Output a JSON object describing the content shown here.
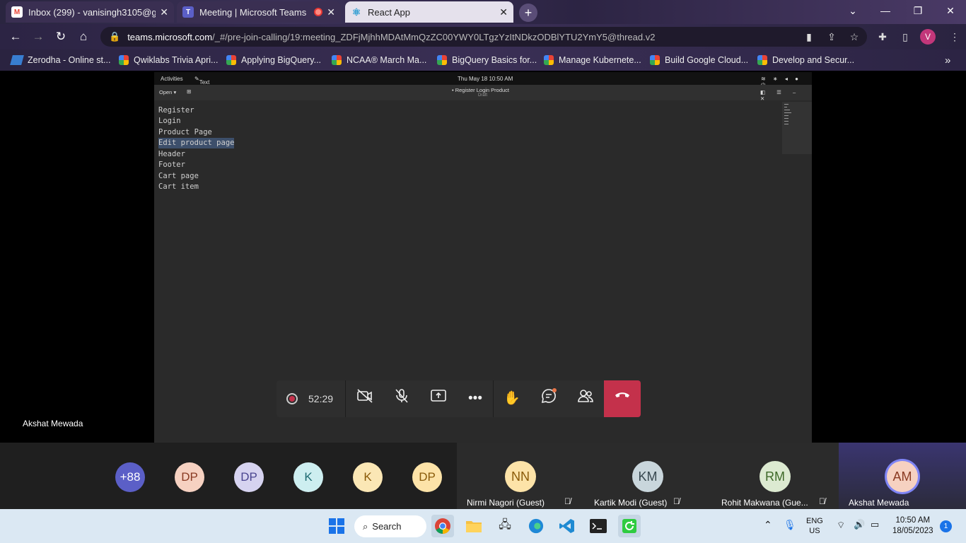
{
  "browser": {
    "tabs": [
      {
        "label": "Inbox (299) - vanisingh3105@gm",
        "icon": "gmail-icon"
      },
      {
        "label": "Meeting | Microsoft Teams",
        "icon": "teams-icon"
      },
      {
        "label": "React App",
        "icon": "react-icon"
      }
    ],
    "url_host": "teams.microsoft.com",
    "url_path": "/_#/pre-join-calling/19:meeting_ZDFjMjhhMDAtMmQzZC00YWY0LTgzYzItNDkzODBlYTU2YmY5@thread.v2",
    "profile_initial": "V",
    "bookmarks": [
      "Zerodha - Online st...",
      "Qwiklabs Trivia Apri...",
      "Applying BigQuery...",
      "NCAA® March Ma...",
      "BigQuery Basics for...",
      "Manage Kubernete...",
      "Build Google Cloud...",
      "Develop and Secur..."
    ]
  },
  "shared_screen": {
    "activities": "Activities",
    "app_name": "Text Editor",
    "clock": "Thu May 18  10:50 AM",
    "open_label": "Open",
    "doc_title": "• Register Login Product",
    "doc_subtitle": "Draft",
    "lines": [
      "Register",
      "Login",
      "Product Page",
      "Edit product page",
      "Header",
      "Footer",
      "Cart page",
      "Cart item"
    ],
    "selected_line": 3
  },
  "call": {
    "timer": "52:29",
    "presenter": "Akshat Mewada"
  },
  "participants": {
    "overflow": "+88",
    "small": [
      {
        "initials": "DP",
        "bg": "#f6d1c1",
        "fg": "#8a3b23"
      },
      {
        "initials": "DP",
        "bg": "#d6d3f0",
        "fg": "#4a4590"
      },
      {
        "initials": "K",
        "bg": "#cdeef0",
        "fg": "#1e6b72"
      },
      {
        "initials": "K",
        "bg": "#fbe7b5",
        "fg": "#8a5b0a"
      },
      {
        "initials": "DP",
        "bg": "#fde3a8",
        "fg": "#8a5b0a"
      }
    ],
    "tiles": [
      {
        "initials": "NN",
        "name": "Nirmi Nagori (Guest)",
        "bg": "#fde3a8",
        "fg": "#8a5b0a"
      },
      {
        "initials": "KM",
        "name": "Kartik Modi (Guest)",
        "bg": "#c9d6dc",
        "fg": "#37474f"
      },
      {
        "initials": "RM",
        "name": "Rohit Makwana (Gue...",
        "bg": "#dcead1",
        "fg": "#3f6a2a"
      },
      {
        "initials": "AM",
        "name": "Akshat Mewada",
        "bg": "#f6d1c1",
        "fg": "#8a3b23"
      }
    ]
  },
  "taskbar": {
    "search_label": "Search",
    "lang_top": "ENG",
    "lang_bottom": "US",
    "time": "10:50 AM",
    "date": "18/05/2023",
    "notification_count": "1"
  }
}
